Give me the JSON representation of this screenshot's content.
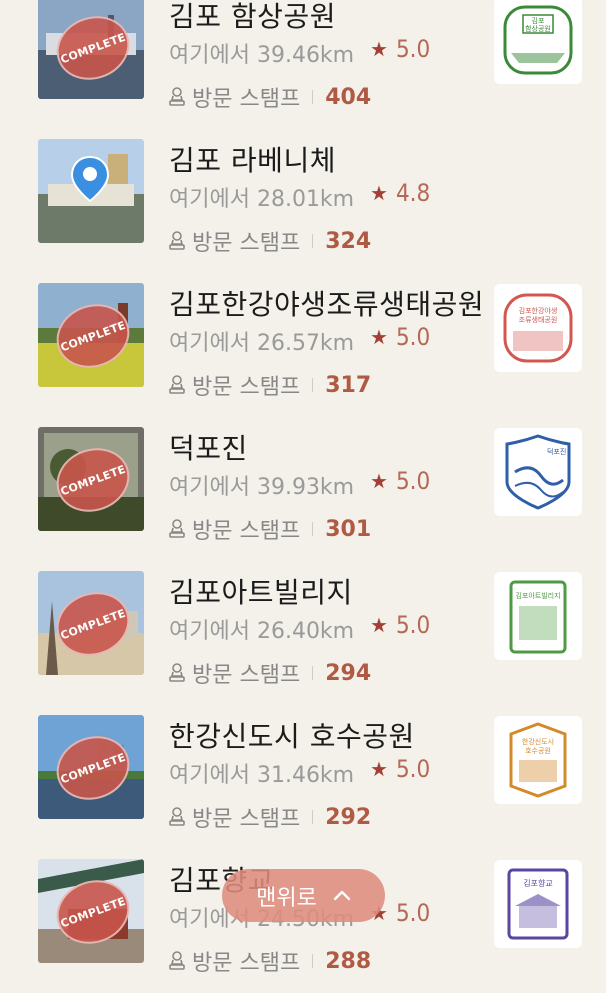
{
  "items": [
    {
      "name": "김포 함상공원",
      "distance": "여기에서 39.46km",
      "rating": "5.0",
      "stamp_label": "방문 스탬프",
      "stamp_count": "404",
      "complete": true,
      "stamp_color": "#3a8a3a",
      "stamp_text": "김포 함상공원"
    },
    {
      "name": "김포 라베니체",
      "distance": "여기에서 28.01km",
      "rating": "4.8",
      "stamp_label": "방문 스탬프",
      "stamp_count": "324",
      "complete": false
    },
    {
      "name": "김포한강야생조류생태공원",
      "distance": "여기에서 26.57km",
      "rating": "5.0",
      "stamp_label": "방문 스탬프",
      "stamp_count": "317",
      "complete": true,
      "stamp_color": "#d2574f",
      "stamp_text": "김포한강야생 조류생태공원"
    },
    {
      "name": "덕포진",
      "distance": "여기에서 39.93km",
      "rating": "5.0",
      "stamp_label": "방문 스탬프",
      "stamp_count": "301",
      "complete": true,
      "stamp_color": "#2f5fa8",
      "stamp_text": "덕포진"
    },
    {
      "name": "김포아트빌리지",
      "distance": "여기에서 26.40km",
      "rating": "5.0",
      "stamp_label": "방문 스탬프",
      "stamp_count": "294",
      "complete": true,
      "stamp_color": "#4f9a45",
      "stamp_text": "김포아트빌리지"
    },
    {
      "name": "한강신도시 호수공원",
      "distance": "여기에서 31.46km",
      "rating": "5.0",
      "stamp_label": "방문 스탬프",
      "stamp_count": "292",
      "complete": true,
      "stamp_color": "#d38a2a",
      "stamp_text": "한강신도시 호수공원"
    },
    {
      "name": "김포향교",
      "distance": "여기에서 24.50km",
      "rating": "5.0",
      "stamp_label": "방문 스탬프",
      "stamp_count": "288",
      "complete": true,
      "stamp_color": "#5a46a0",
      "stamp_text": "김포향교"
    }
  ],
  "badge_text": "COMPLETE",
  "scroll_top_label": "맨위로"
}
